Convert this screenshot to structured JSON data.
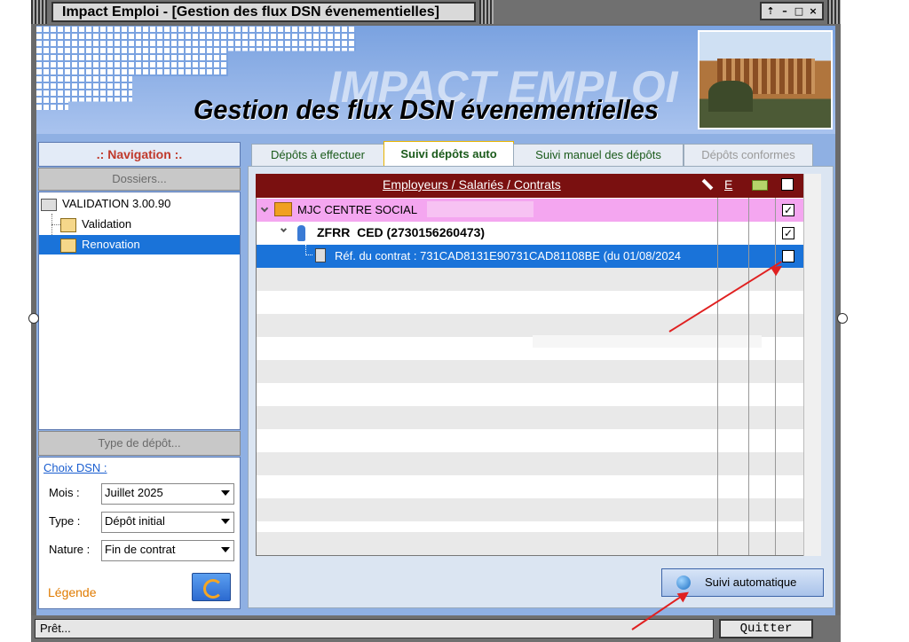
{
  "window": {
    "title": "Impact Emploi - [Gestion des flux DSN évenementielles]",
    "controls": [
      "⇡",
      "–",
      "□",
      "×"
    ]
  },
  "banner": {
    "brand": "IMPACT EMPLOI",
    "subtitle": "Gestion des flux DSN évenementielles"
  },
  "navigation": {
    "header": ".: Navigation :.",
    "dossiers": "Dossiers...",
    "tree": [
      {
        "label": "VALIDATION 3.00.90",
        "selected": false
      },
      {
        "label": "Validation",
        "selected": false
      },
      {
        "label": "Renovation",
        "selected": true
      }
    ],
    "type_depot": "Type de dépôt..."
  },
  "choix": {
    "title": "Choix DSN :",
    "mois_label": "Mois :",
    "mois_value": "Juillet 2025",
    "type_label": "Type :",
    "type_value": "Dépôt initial",
    "nature_label": "Nature :",
    "nature_value": "Fin de contrat",
    "legende": "Légende"
  },
  "tabs": [
    {
      "label": "Dépôts à effectuer",
      "active": false
    },
    {
      "label": "Suivi dépôts auto",
      "active": true
    },
    {
      "label": "Suivi manuel des dépôts",
      "active": false
    },
    {
      "label": "Dépôts conformes",
      "active": false
    }
  ],
  "grid": {
    "header": "Employeurs / Salariés / Contrats",
    "col_e": "E",
    "rows": [
      {
        "text": "MJC CENTRE SOCIAL",
        "checked": true
      },
      {
        "text": "ZFRR  CED (2730156260473)",
        "checked": true
      },
      {
        "text": "Réf. du contrat : 731CAD8131E90731CAD81108BE (du 01/08/2024",
        "checked": true
      }
    ]
  },
  "buttons": {
    "suivi_auto": "Suivi automatique",
    "quitter": "Quitter"
  },
  "status": "Prêt...",
  "colors": {
    "grid_header": "#7a1010",
    "employer_row": "#f4a6f0",
    "selected_row": "#1a73d9",
    "client_bg": "#8fb0e3",
    "annotation_arrow": "#e02020"
  }
}
